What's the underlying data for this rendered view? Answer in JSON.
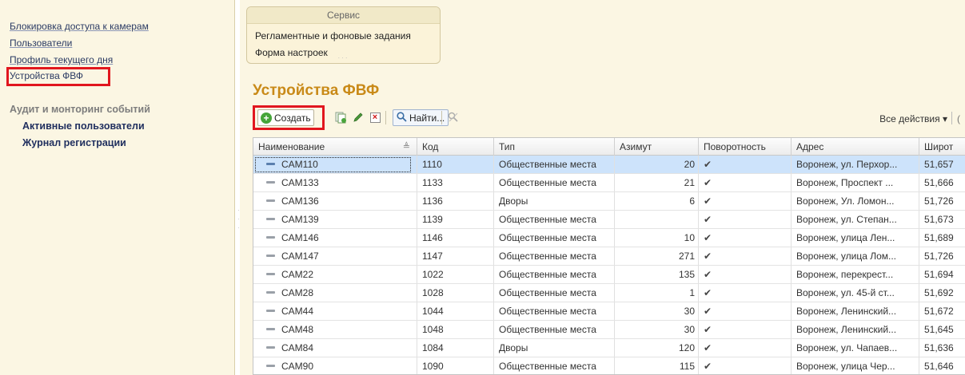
{
  "sidebar": {
    "links": [
      {
        "label": "Блокировка доступа к камерам"
      },
      {
        "label": "Пользователи"
      },
      {
        "label": "Профиль текущего дня"
      },
      {
        "label": "Устройства ФВФ"
      }
    ],
    "group_title": "Аудит и монторинг событий",
    "group_links": [
      {
        "label": "Активные пользователи"
      },
      {
        "label": "Журнал регистрации"
      }
    ]
  },
  "service": {
    "title": "Сервис",
    "items": [
      {
        "label": "Регламентные и фоновые задания"
      },
      {
        "label": "Форма настроек"
      }
    ]
  },
  "page": {
    "title": "Устройства ФВФ"
  },
  "toolbar": {
    "create_label": "Создать",
    "find_label": "Найти...",
    "all_actions_label": "Все действия ▾",
    "more_label": "("
  },
  "table": {
    "columns": [
      "Наименование",
      "Код",
      "Тип",
      "Азимут",
      "Поворотность",
      "Адрес",
      "Широт"
    ],
    "rows": [
      {
        "name": "CAM110",
        "code": "1110",
        "type": "Общественные места",
        "azimuth": "20",
        "rotating": "✔",
        "address": "Воронеж, ул. Перхор...",
        "lat": "51,657"
      },
      {
        "name": "CAM133",
        "code": "1133",
        "type": "Общественные места",
        "azimuth": "21",
        "rotating": "✔",
        "address": "Воронеж, Проспект ...",
        "lat": "51,666"
      },
      {
        "name": "CAM136",
        "code": "1136",
        "type": "Дворы",
        "azimuth": "6",
        "rotating": "✔",
        "address": "Воронеж, Ул. Ломон...",
        "lat": "51,726"
      },
      {
        "name": "CAM139",
        "code": "1139",
        "type": "Общественные места",
        "azimuth": "",
        "rotating": "✔",
        "address": "Воронеж, ул. Степан...",
        "lat": "51,673"
      },
      {
        "name": "CAM146",
        "code": "1146",
        "type": "Общественные места",
        "azimuth": "10",
        "rotating": "✔",
        "address": "Воронеж, улица Лен...",
        "lat": "51,689"
      },
      {
        "name": "CAM147",
        "code": "1147",
        "type": "Общественные места",
        "azimuth": "271",
        "rotating": "✔",
        "address": "Воронеж, улица Лом...",
        "lat": "51,726"
      },
      {
        "name": "CAM22",
        "code": "1022",
        "type": "Общественные места",
        "azimuth": "135",
        "rotating": "✔",
        "address": "Воронеж, перекрест...",
        "lat": "51,694"
      },
      {
        "name": "CAM28",
        "code": "1028",
        "type": "Общественные места",
        "azimuth": "1",
        "rotating": "✔",
        "address": "Воронеж, ул. 45-й ст...",
        "lat": "51,692"
      },
      {
        "name": "CAM44",
        "code": "1044",
        "type": "Общественные места",
        "azimuth": "30",
        "rotating": "✔",
        "address": "Воронеж, Ленинский...",
        "lat": "51,672"
      },
      {
        "name": "CAM48",
        "code": "1048",
        "type": "Общественные места",
        "azimuth": "30",
        "rotating": "✔",
        "address": "Воронеж, Ленинский...",
        "lat": "51,645"
      },
      {
        "name": "CAM84",
        "code": "1084",
        "type": "Дворы",
        "azimuth": "120",
        "rotating": "✔",
        "address": "Воронеж, ул. Чапаев...",
        "lat": "51,636"
      },
      {
        "name": "CAM90",
        "code": "1090",
        "type": "Общественные места",
        "azimuth": "115",
        "rotating": "✔",
        "address": "Воронеж, улица Чер...",
        "lat": "51,646"
      }
    ]
  }
}
